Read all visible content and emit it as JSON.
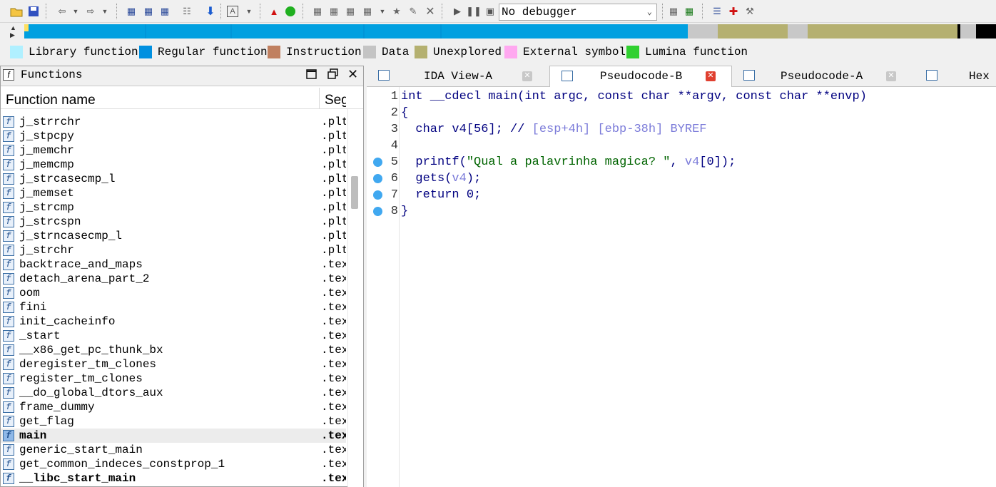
{
  "toolbar": {
    "debugger_select": "No debugger",
    "icons": [
      "open-file-icon",
      "save-icon",
      "back-icon",
      "back-dropdown-icon",
      "forward-icon",
      "forward-dropdown-icon",
      "jump-icon",
      "jump-icon",
      "jump-icon",
      "search-icon",
      "down-arrow-icon",
      "text-icon",
      "text-dropdown-icon",
      "stop-icon",
      "green-circle-icon",
      "graph-icon",
      "graph-icon",
      "graph-icon",
      "graph-icon",
      "graph-dropdown-icon",
      "graph-icon",
      "edit-icon",
      "close-icon",
      "play-icon",
      "pause-icon",
      "stop-square-icon",
      "dropdown-icon",
      "debug-icon",
      "debug-icon",
      "list-icon",
      "add-icon",
      "tool-icon"
    ]
  },
  "nav_band": {
    "colors": {
      "regular": "#00a0e0",
      "unexplored": "#b5b070",
      "gray": "#c8c8c8",
      "black": "#000000",
      "library": "#b0e8f8"
    }
  },
  "legend": [
    {
      "label": "Library function",
      "color": "#b0f0ff"
    },
    {
      "label": "Regular function",
      "color": "#0090e0"
    },
    {
      "label": "Instruction",
      "color": "#c08060"
    },
    {
      "label": "Data",
      "color": "#c4c4c4"
    },
    {
      "label": "Unexplored",
      "color": "#b4b070"
    },
    {
      "label": "External symbol",
      "color": "#ffa8f0"
    },
    {
      "label": "Lumina function",
      "color": "#30d030"
    }
  ],
  "functions_panel": {
    "title": "Functions",
    "col_name": "Function name",
    "col_seg": "Segment",
    "rows": [
      {
        "name": "j_strrchr",
        "seg": ".plt"
      },
      {
        "name": "j_stpcpy",
        "seg": ".plt"
      },
      {
        "name": "j_memchr",
        "seg": ".plt"
      },
      {
        "name": "j_memcmp",
        "seg": ".plt"
      },
      {
        "name": "j_strcasecmp_l",
        "seg": ".plt"
      },
      {
        "name": "j_memset",
        "seg": ".plt"
      },
      {
        "name": "j_strcmp",
        "seg": ".plt"
      },
      {
        "name": "j_strcspn",
        "seg": ".plt"
      },
      {
        "name": "j_strncasecmp_l",
        "seg": ".plt"
      },
      {
        "name": "j_strchr",
        "seg": ".plt"
      },
      {
        "name": "backtrace_and_maps",
        "seg": ".text"
      },
      {
        "name": "detach_arena_part_2",
        "seg": ".text"
      },
      {
        "name": "oom",
        "seg": ".text"
      },
      {
        "name": "fini",
        "seg": ".text"
      },
      {
        "name": "init_cacheinfo",
        "seg": ".text"
      },
      {
        "name": "_start",
        "seg": ".text"
      },
      {
        "name": "__x86_get_pc_thunk_bx",
        "seg": ".text"
      },
      {
        "name": "deregister_tm_clones",
        "seg": ".text"
      },
      {
        "name": "register_tm_clones",
        "seg": ".text"
      },
      {
        "name": "__do_global_dtors_aux",
        "seg": ".text"
      },
      {
        "name": "frame_dummy",
        "seg": ".text"
      },
      {
        "name": "get_flag",
        "seg": ".text"
      },
      {
        "name": "main",
        "seg": ".text",
        "selected": true
      },
      {
        "name": "generic_start_main",
        "seg": ".text"
      },
      {
        "name": "get_common_indeces_constprop_1",
        "seg": ".text"
      },
      {
        "name": "__libc_start_main",
        "seg": ".text",
        "bold": true
      }
    ]
  },
  "tabs": [
    {
      "label": "IDA View-A",
      "active": false
    },
    {
      "label": "Pseudocode-B",
      "active": true
    },
    {
      "label": "Pseudocode-A",
      "active": false
    },
    {
      "label": "Hex",
      "active": false
    }
  ],
  "code": {
    "lines": [
      {
        "n": "1",
        "dot": false,
        "parts": [
          {
            "t": "int __cdecl main(int argc, const char **argv, const char **envp)",
            "c": ""
          }
        ]
      },
      {
        "n": "2",
        "dot": false,
        "parts": [
          {
            "t": "{",
            "c": ""
          }
        ]
      },
      {
        "n": "3",
        "dot": false,
        "parts": [
          {
            "t": "  char v4[56]; // ",
            "c": ""
          },
          {
            "t": "[esp+4h] [ebp-38h] BYREF",
            "c": "grey"
          }
        ]
      },
      {
        "n": "4",
        "dot": false,
        "parts": [
          {
            "t": "",
            "c": ""
          }
        ]
      },
      {
        "n": "5",
        "dot": true,
        "parts": [
          {
            "t": "  printf(",
            "c": ""
          },
          {
            "t": "\"Qual a palavrinha magica? \"",
            "c": "str"
          },
          {
            "t": ", ",
            "c": ""
          },
          {
            "t": "v4",
            "c": "grey"
          },
          {
            "t": "[0]);",
            "c": ""
          }
        ]
      },
      {
        "n": "6",
        "dot": true,
        "parts": [
          {
            "t": "  gets(",
            "c": ""
          },
          {
            "t": "v4",
            "c": "grey"
          },
          {
            "t": ");",
            "c": ""
          }
        ]
      },
      {
        "n": "7",
        "dot": true,
        "parts": [
          {
            "t": "  return 0;",
            "c": ""
          }
        ]
      },
      {
        "n": "8",
        "dot": true,
        "parts": [
          {
            "t": "}",
            "c": ""
          }
        ]
      }
    ]
  }
}
